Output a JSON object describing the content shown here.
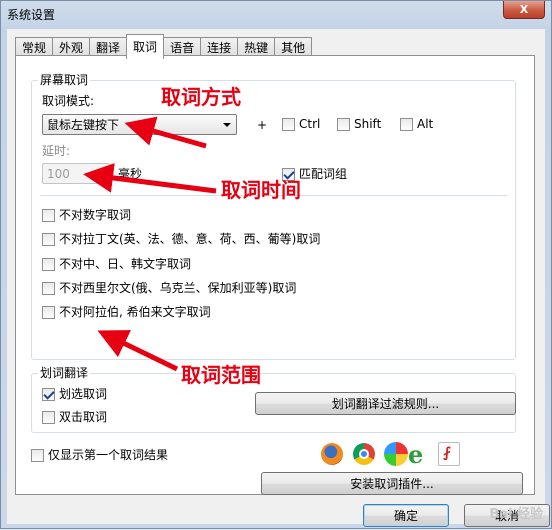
{
  "window": {
    "title": "系统设置",
    "close_glyph": "X"
  },
  "tabs": [
    {
      "label": "常规"
    },
    {
      "label": "外观"
    },
    {
      "label": "翻译"
    },
    {
      "label": "取词",
      "active": true
    },
    {
      "label": "语音"
    },
    {
      "label": "连接"
    },
    {
      "label": "热键"
    },
    {
      "label": "其他"
    }
  ],
  "screen_capture": {
    "group_title": "屏幕取词",
    "mode_label": "取词模式:",
    "mode_value": "鼠标左键按下",
    "plus": "+",
    "modifiers": [
      {
        "label": "Ctrl",
        "checked": false
      },
      {
        "label": "Shift",
        "checked": false
      },
      {
        "label": "Alt",
        "checked": false
      }
    ],
    "delay_label": "延时:",
    "delay_value": "100",
    "delay_unit": "毫秒",
    "match_group": {
      "label": "匹配词组",
      "checked": true
    },
    "exclusions": [
      {
        "label": "不对数字取词",
        "checked": false
      },
      {
        "label": "不对拉丁文(英、法、德、意、荷、西、葡等)取词",
        "checked": false
      },
      {
        "label": "不对中、日、韩文字取词",
        "checked": false
      },
      {
        "label": "不对西里尔文(俄、乌克兰、保加利亚等)取词",
        "checked": false
      },
      {
        "label": "不对阿拉伯, 希伯来文字取词",
        "checked": false
      }
    ]
  },
  "selection_translate": {
    "group_title": "划词翻译",
    "options": [
      {
        "label": "划选取词",
        "checked": true
      },
      {
        "label": "双击取词",
        "checked": false
      }
    ],
    "filter_button": "划词翻译过滤规则..."
  },
  "first_result_only": {
    "label": "仅显示第一个取词结果",
    "checked": false
  },
  "install_plugin_button": "安装取词插件...",
  "plugin_icons": [
    "firefox-icon",
    "chrome-icon",
    "ie-icon",
    "ie-alt-icon",
    "pdf-icon"
  ],
  "footer": {
    "ok": "确定",
    "cancel": "取消"
  },
  "annotations": {
    "mode": "取词方式",
    "time": "取词时间",
    "range": "取词范围",
    "color": "#e60012"
  },
  "watermark": "Bai 经验"
}
